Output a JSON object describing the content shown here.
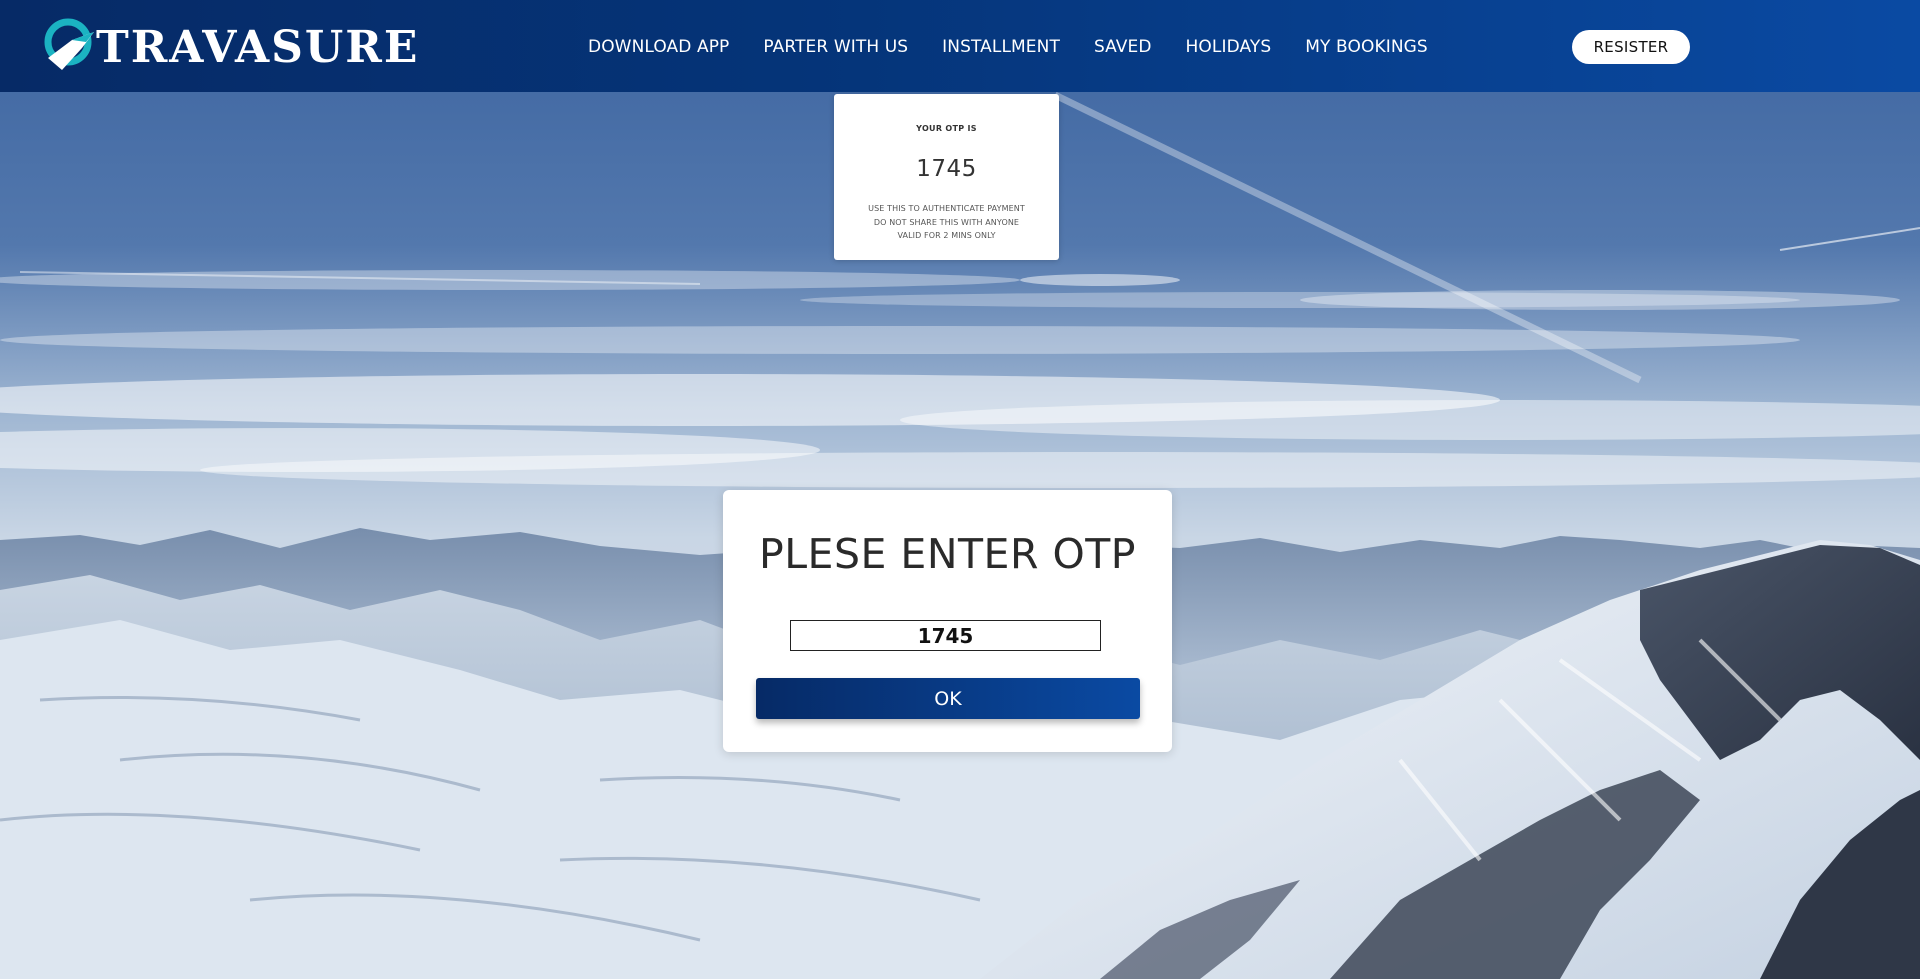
{
  "brand": {
    "name": "TRAVASURE",
    "primary_color": "#062a66",
    "secondary_color": "#0a4aa3",
    "accent_color": "#1bb3c2"
  },
  "nav": {
    "items": [
      {
        "label": "DOWNLOAD APP"
      },
      {
        "label": "PARTER WITH US"
      },
      {
        "label": "INSTALLMENT"
      },
      {
        "label": "SAVED"
      },
      {
        "label": "HOLIDAYS"
      },
      {
        "label": "MY BOOKINGS"
      }
    ],
    "register_label": "RESISTER"
  },
  "otp_notification": {
    "title": "YOUR OTP IS",
    "code": "1745",
    "notes": [
      "USE THIS TO AUTHENTICATE PAYMENT",
      "DO NOT SHARE THIS WITH ANYONE",
      "VALID FOR 2 MINS ONLY"
    ]
  },
  "otp_modal": {
    "title": "PLESE ENTER OTP",
    "input_value": "1745",
    "ok_label": "OK"
  },
  "background": {
    "icon": "snowy-mountains-background"
  }
}
